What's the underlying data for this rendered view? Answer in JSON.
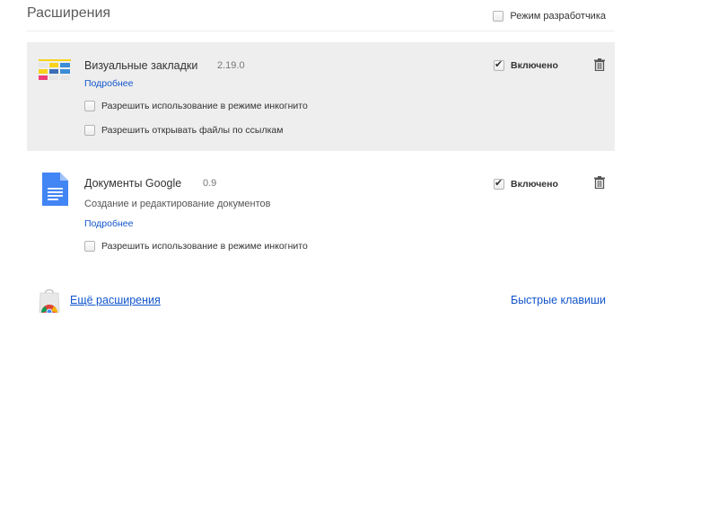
{
  "header": {
    "title": "Расширения",
    "dev_mode_label": "Режим разработчика",
    "dev_mode_checked": false
  },
  "extensions": [
    {
      "name": "Визуальные закладки",
      "version": "2.19.0",
      "description": "",
      "details_link": "Подробнее",
      "options": [
        {
          "label": "Разрешить использование в режиме инкогнито",
          "checked": false
        },
        {
          "label": "Разрешить открывать файлы по ссылкам",
          "checked": false
        }
      ],
      "enabled_label": "Включено",
      "enabled": true,
      "icon": "visual-bookmarks-icon",
      "trash_icon": "trash-icon"
    },
    {
      "name": "Документы Google",
      "version": "0.9",
      "description": "Создание и редактирование документов",
      "details_link": "Подробнее",
      "options": [
        {
          "label": "Разрешить использование в режиме инкогнито",
          "checked": false
        }
      ],
      "enabled_label": "Включено",
      "enabled": true,
      "icon": "google-docs-icon",
      "trash_icon": "trash-icon"
    }
  ],
  "footer": {
    "more_extensions": "Ещё расширения",
    "shortcuts": "Быстрые клавиши",
    "store_icon": "chrome-web-store-icon"
  },
  "colors": {
    "link": "#1155cc",
    "selected_bg": "#eeeeee",
    "docs_blue": "#4285f4"
  }
}
